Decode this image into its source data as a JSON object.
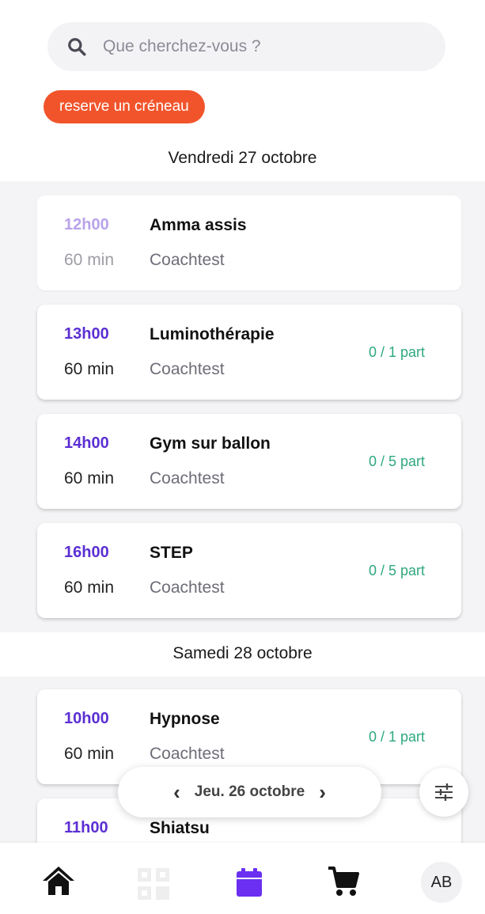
{
  "search": {
    "placeholder": "Que cherchez-vous ?"
  },
  "reserve_button": "reserve un créneau",
  "days": [
    {
      "date": "Vendredi 27 octobre",
      "sessions": [
        {
          "time": "12h00",
          "duration": "60 min",
          "title": "Amma assis",
          "coach": "Coachtest",
          "participants": ""
        },
        {
          "time": "13h00",
          "duration": "60 min",
          "title": "Luminothérapie",
          "coach": "Coachtest",
          "participants": "0 / 1 part"
        },
        {
          "time": "14h00",
          "duration": "60 min",
          "title": "Gym sur ballon",
          "coach": "Coachtest",
          "participants": "0 / 5 part"
        },
        {
          "time": "16h00",
          "duration": "60 min",
          "title": "STEP",
          "coach": "Coachtest",
          "participants": "0 / 5 part"
        }
      ]
    },
    {
      "date": "Samedi 28 octobre",
      "sessions": [
        {
          "time": "10h00",
          "duration": "60 min",
          "title": "Hypnose",
          "coach": "Coachtest",
          "participants": "0 / 1 part"
        },
        {
          "time": "11h00",
          "duration": "",
          "title": "Shiatsu",
          "coach": "",
          "participants": ""
        }
      ]
    }
  ],
  "date_navigator": {
    "label": "Jeu. 26 octobre",
    "prev": "‹",
    "next": "›"
  },
  "bottom_nav": {
    "items": [
      {
        "icon": "home-icon"
      },
      {
        "icon": "qr-code-icon"
      },
      {
        "icon": "calendar-icon",
        "active": true
      },
      {
        "icon": "cart-icon"
      }
    ],
    "avatar_initials": "AB"
  },
  "colors": {
    "accent": "#5b2fd3",
    "reserve": "#f1542b",
    "capacity": "#2fa87d"
  }
}
